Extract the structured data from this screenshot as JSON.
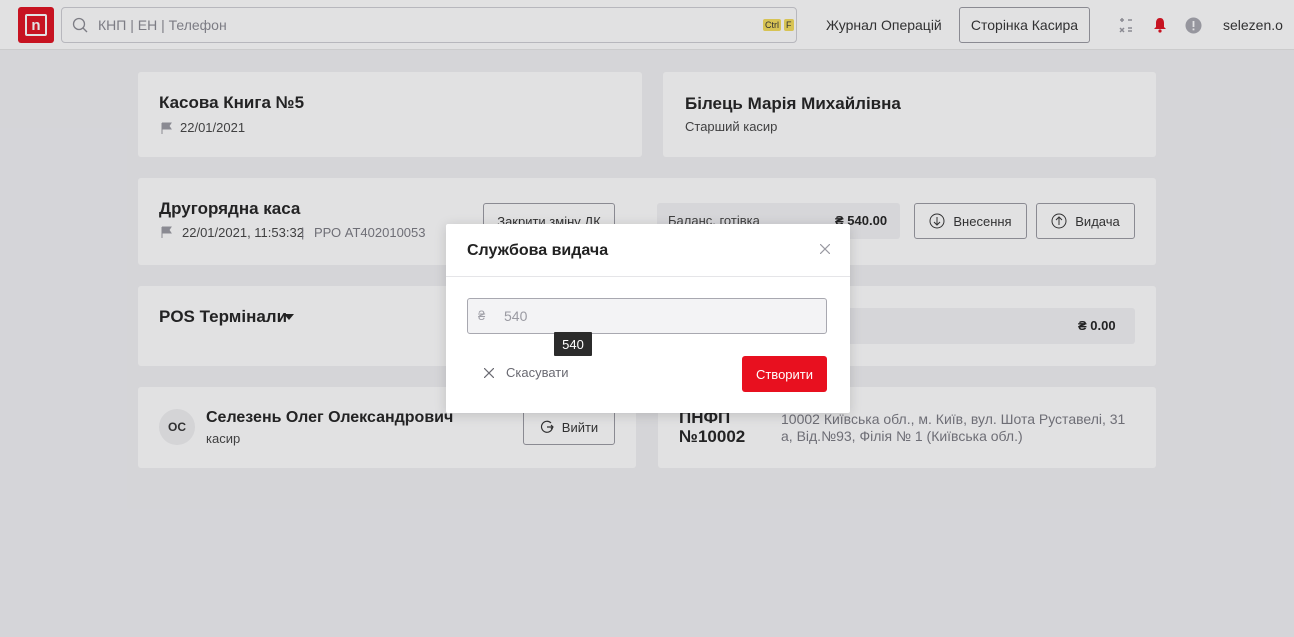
{
  "header": {
    "logo_letter": "n",
    "search_placeholder": "КНП | ЕН | Телефон",
    "shortcut_keys": [
      "Ctrl",
      "F"
    ],
    "journal_link": "Журнал Операцій",
    "cashier_page_button": "Сторінка Касира",
    "username": "selezen.o",
    "icons": [
      "search-icon",
      "grid-icon",
      "bell-icon",
      "alert-icon"
    ],
    "colors": {
      "brand": "#e1101f",
      "bell": "#e1101f"
    }
  },
  "cashbook": {
    "title": "Касова Книга №5",
    "date": "22/01/2021"
  },
  "cashier_card": {
    "name": "Білець Марія Михайлівна",
    "role": "Старший касир"
  },
  "register": {
    "title": "Другорядна каса",
    "datetime": "22/01/2021, 11:53:32",
    "rro": "РРО AT402010053",
    "close_shift_button": "Закрити зміну ДК",
    "balance_label": "Баланс, готівка",
    "balance_value": "₴ 540.00",
    "deposit_button": "Внесення",
    "withdraw_button": "Видача"
  },
  "pos": {
    "title": "POS Термінали",
    "right_value": "₴ 0.00"
  },
  "user_card": {
    "initials": "ОС",
    "name": "Селезень Олег Олександрович",
    "role": "касир",
    "logout_button": "Вийти"
  },
  "branch_card": {
    "code_line1": "ПНФП",
    "code_line2": "№10002",
    "address": "10002 Київська обл., м. Київ, вул. Шота Руставелі, 31 а, Від.№93, Філія № 1 (Київська обл.)"
  },
  "modal": {
    "title": "Службова видача",
    "currency": "₴",
    "amount_value": "540",
    "tooltip": "540",
    "cancel_button": "Скасувати",
    "create_button": "Створити",
    "colors": {
      "primary": "#e8101f"
    }
  }
}
